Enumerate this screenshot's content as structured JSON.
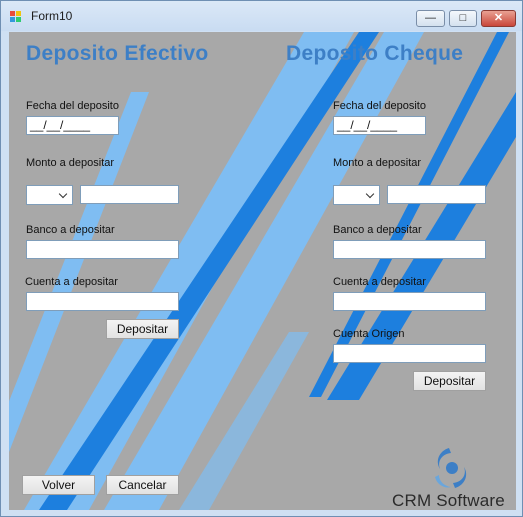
{
  "window": {
    "title": "Form10",
    "minimize_glyph": "—",
    "maximize_glyph": "□",
    "close_glyph": "✕"
  },
  "efectivo": {
    "heading": "Deposito Efectivo",
    "fecha_label": "Fecha del deposito",
    "fecha_value": "__/__/____",
    "monto_label": "Monto a depositar",
    "monto_value": "",
    "moneda_selected": "",
    "banco_label": "Banco a depositar",
    "banco_value": "",
    "cuenta_label": "Cuenta a depositar",
    "cuenta_value": "",
    "depositar_label": "Depositar"
  },
  "cheque": {
    "heading": "Deposito Cheque",
    "fecha_label": "Fecha del deposito",
    "fecha_value": "__/__/____",
    "monto_label": "Monto a depositar",
    "monto_value": "",
    "moneda_selected": "",
    "banco_label": "Banco a depositar",
    "banco_value": "",
    "cuenta_label": "Cuenta a depositar",
    "cuenta_value": "",
    "origen_label": "Cuenta Origen",
    "origen_value": "",
    "depositar_label": "Depositar"
  },
  "footer": {
    "volver_label": "Volver",
    "cancelar_label": "Cancelar"
  },
  "brand": {
    "name": "CRM Software",
    "logo_icon": "crm-swirl-logo",
    "accent": "#3d7fc6",
    "stripe_dark": "#1d7fde",
    "stripe_light": "#7fbdf2"
  }
}
